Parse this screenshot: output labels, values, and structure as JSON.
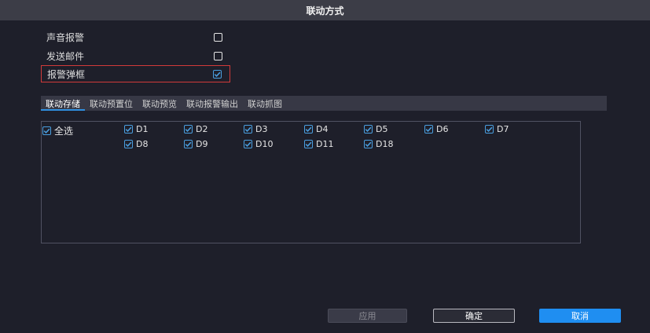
{
  "window": {
    "title": "联动方式"
  },
  "options": [
    {
      "label": "声音报警",
      "checked": false
    },
    {
      "label": "发送邮件",
      "checked": false
    },
    {
      "label": "报警弹框",
      "checked": true
    }
  ],
  "tabs": [
    "联动存储",
    "联动预置位",
    "联动预览",
    "联动报警输出",
    "联动抓图"
  ],
  "select_all": {
    "label": "全选",
    "checked": true
  },
  "channels": [
    "D1",
    "D2",
    "D3",
    "D4",
    "D5",
    "D6",
    "D7",
    "D8",
    "D9",
    "D10",
    "D11",
    "D18"
  ],
  "buttons": {
    "apply": "应用",
    "ok": "确定",
    "cancel": "取消"
  },
  "colors": {
    "accent": "#1f8ef1",
    "highlight_border": "#d23a3a",
    "checkbox_blue": "#4a9fe0"
  }
}
